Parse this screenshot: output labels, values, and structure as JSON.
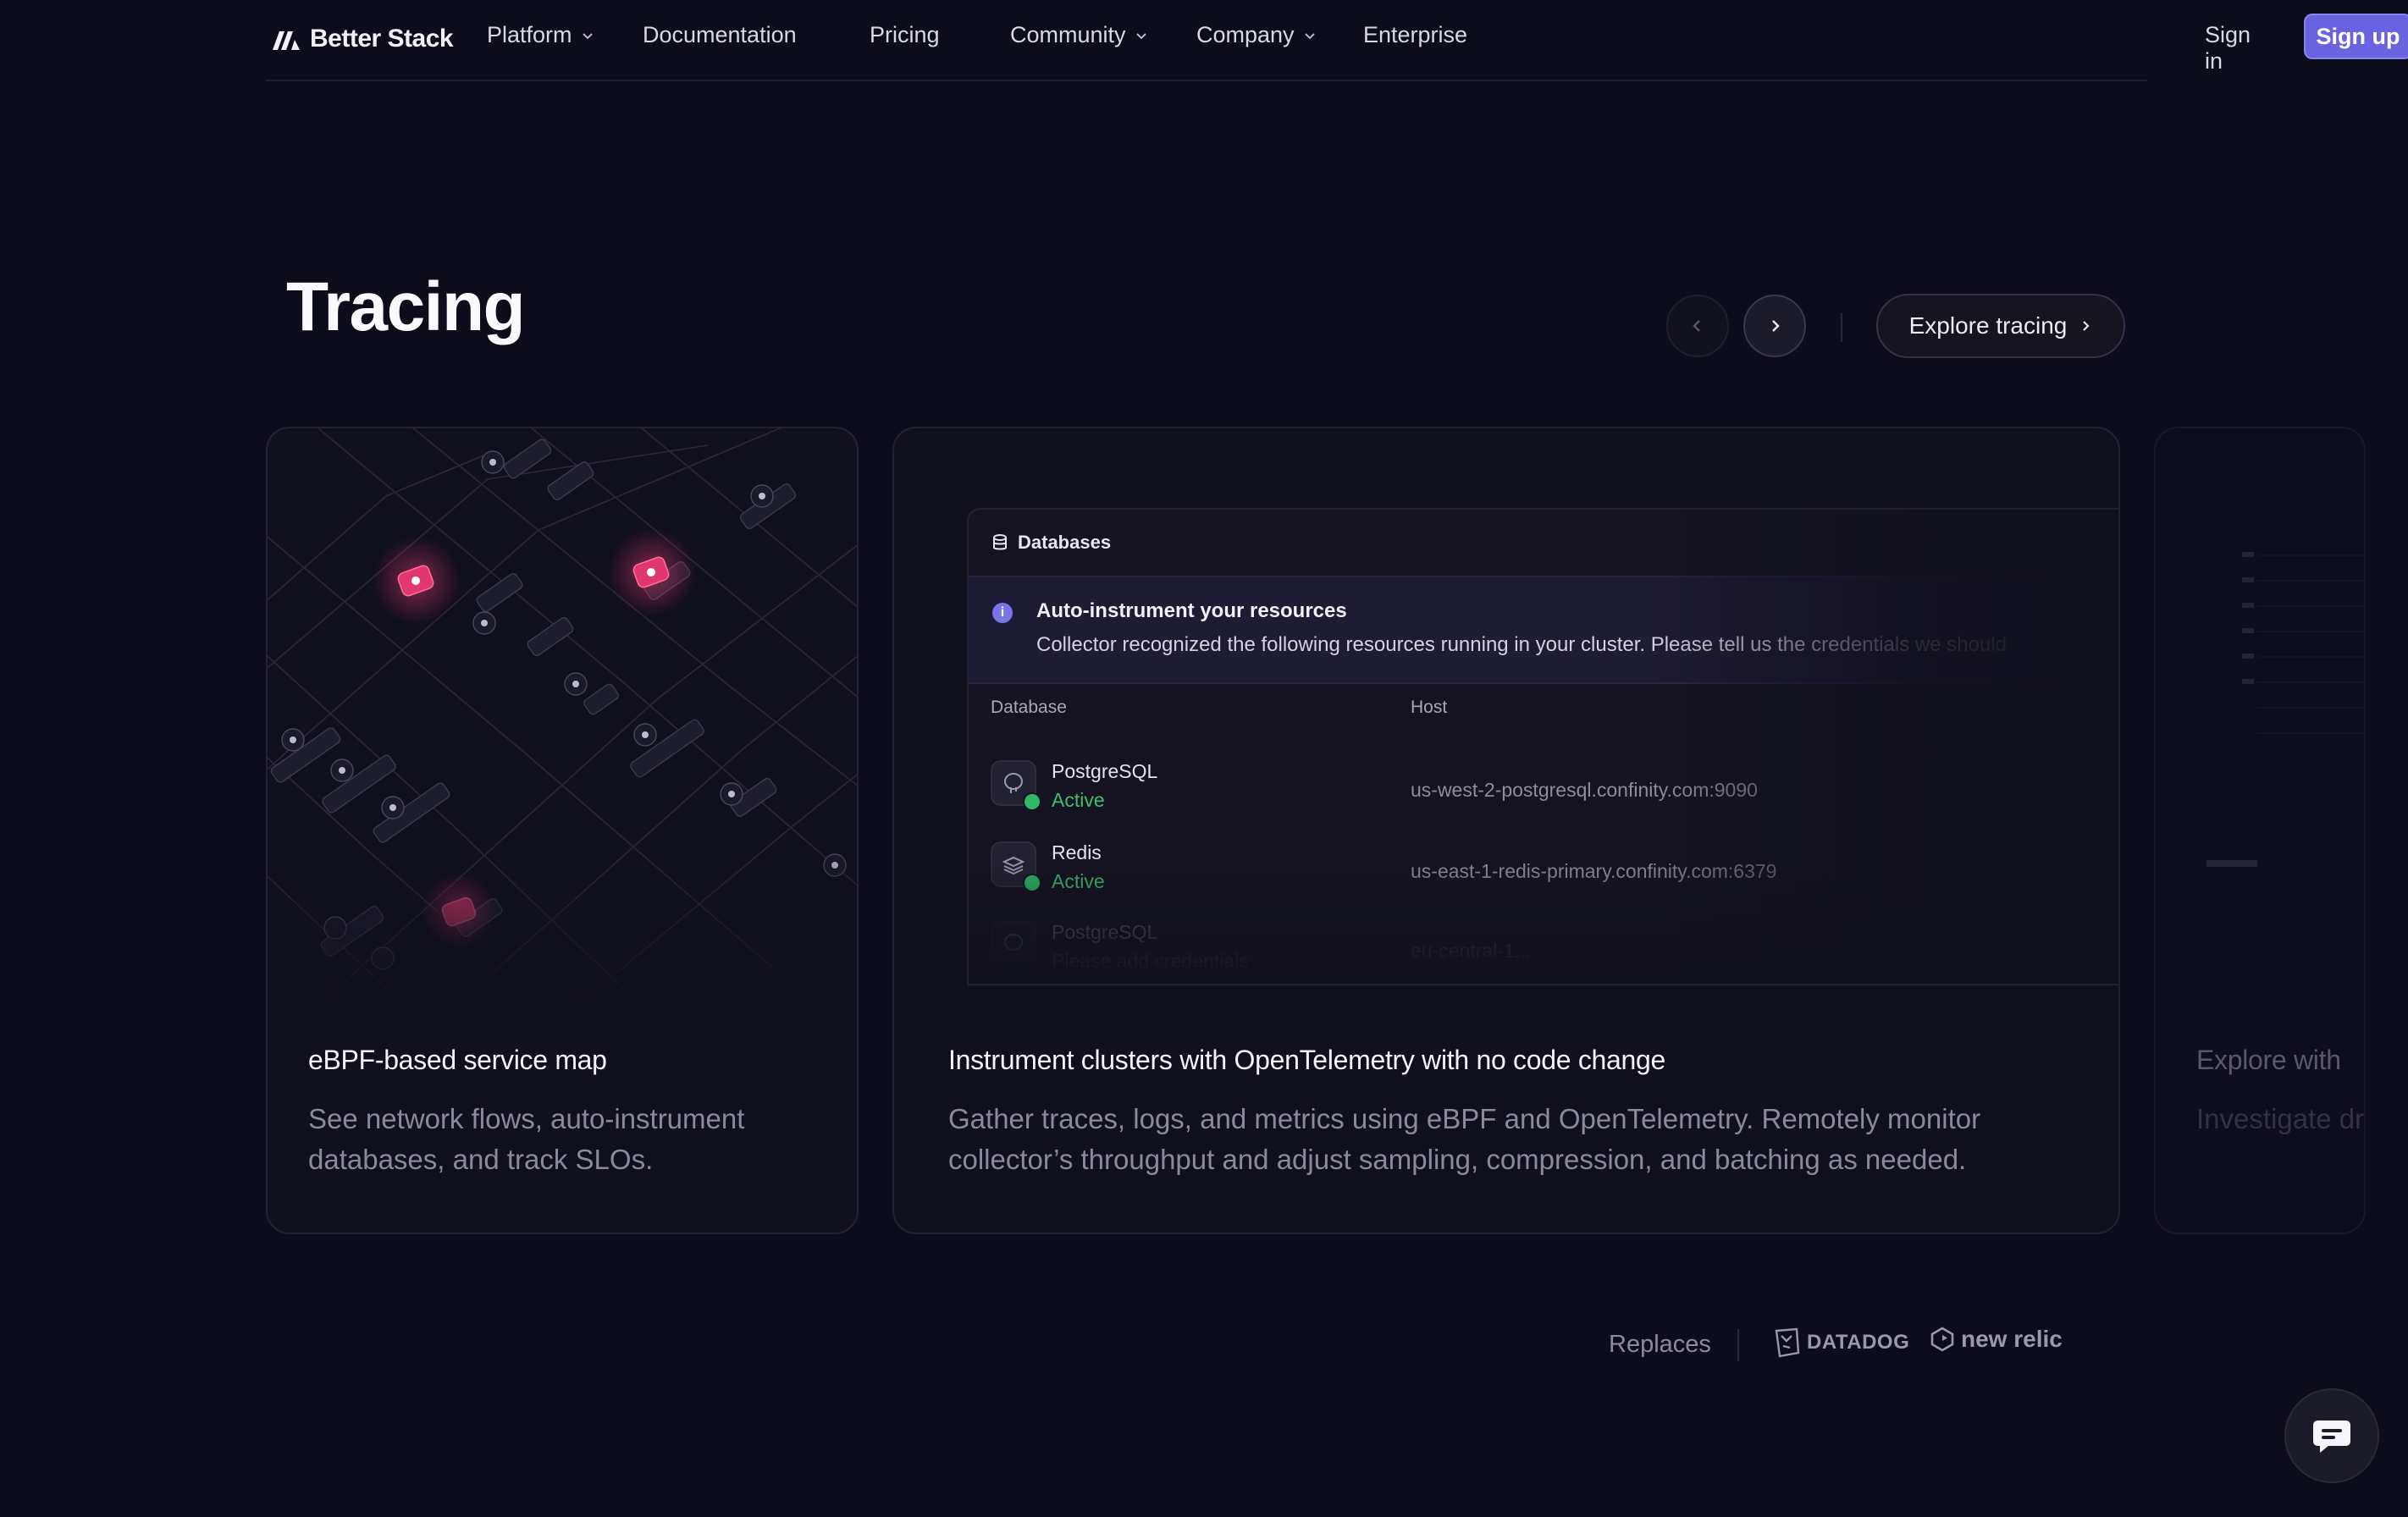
{
  "nav": {
    "logo_text": "Better Stack",
    "items": [
      {
        "label": "Platform",
        "has_dropdown": true
      },
      {
        "label": "Documentation",
        "has_dropdown": false
      },
      {
        "label": "Pricing",
        "has_dropdown": false
      },
      {
        "label": "Community",
        "has_dropdown": true
      },
      {
        "label": "Company",
        "has_dropdown": true
      },
      {
        "label": "Enterprise",
        "has_dropdown": false
      }
    ],
    "sign_in": "Sign in",
    "sign_up": "Sign up"
  },
  "section": {
    "title": "Tracing",
    "explore_label": "Explore tracing"
  },
  "cards": [
    {
      "title": "eBPF-based service map",
      "description": "See network flows, auto-instrument databases, and track SLOs."
    },
    {
      "title": "Instrument clusters with OpenTelemetry with no code change",
      "description": "Gather traces, logs, and metrics using eBPF and OpenTelemetry. Remotely monitor collector’s throughput and adjust sampling, compression, and batching as needed.",
      "panel": {
        "header": "Databases",
        "alert_title": "Auto-instrument your resources",
        "alert_text": "Collector recognized the following resources running in your cluster. Please tell us the credentials we should",
        "col_database": "Database",
        "col_host": "Host",
        "rows": [
          {
            "name": "PostgreSQL",
            "status": "Active",
            "host": "us-west-2-postgresql.confinity.com:9090"
          },
          {
            "name": "Redis",
            "status": "Active",
            "host": "us-east-1-redis-primary.confinity.com:6379"
          },
          {
            "name": "PostgreSQL",
            "status": "Please add credentials",
            "host": "eu-central-1..."
          }
        ]
      }
    },
    {
      "title": "Explore with",
      "description": "Investigate drag & dro"
    }
  ],
  "replaces": {
    "label": "Replaces",
    "brands": [
      "DATADOG",
      "new relic"
    ]
  },
  "colors": {
    "background": "#0d0c1a",
    "accent": "#6a63e0",
    "active": "#3dbf6e",
    "node_highlight": "#e0386e"
  }
}
